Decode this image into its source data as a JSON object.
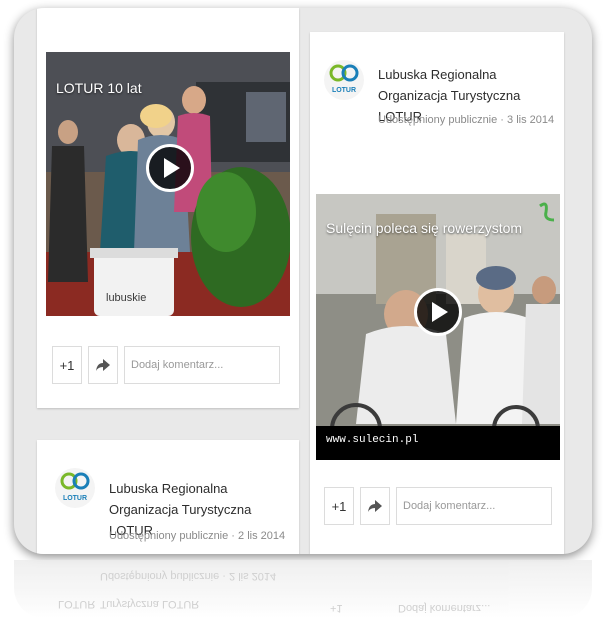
{
  "left_video_post": {
    "video_title": "LOTUR 10 lat",
    "stand_text": "lubuskie",
    "plus_one": "+1",
    "comment_placeholder": "Dodaj komentarz..."
  },
  "right_post": {
    "author": "Lubuska Regionalna Organizacja Turystyczna LOTUR",
    "logo_text": "LOTUR",
    "meta": "Udostępniony publicznie · 3 lis 2014",
    "video_title": "Sulęcin poleca się rowerzystom",
    "video_url": "www.sulecin.pl",
    "plus_one": "+1",
    "comment_placeholder": "Dodaj komentarz..."
  },
  "left_post": {
    "author": "Lubuska Regionalna Organizacja Turystyczna LOTUR",
    "logo_text": "LOTUR",
    "meta": "Udostępniony publicznie · 2 lis 2014"
  },
  "reflection": {
    "meta": "Udostępniony publicznie · 2 lis 2014",
    "name": "Turystyczna LOTUR",
    "logo_text": "LOTUR",
    "plus_one": "+1",
    "comment_placeholder": "Dodaj komentarz..."
  },
  "colors": {
    "background": "#e9e9e9",
    "card": "#ffffff",
    "logo_blue": "#1a7fb8",
    "logo_green": "#7ab829"
  },
  "icons": [
    "play-icon",
    "share-arrow-icon",
    "lotur-logo-icon"
  ]
}
